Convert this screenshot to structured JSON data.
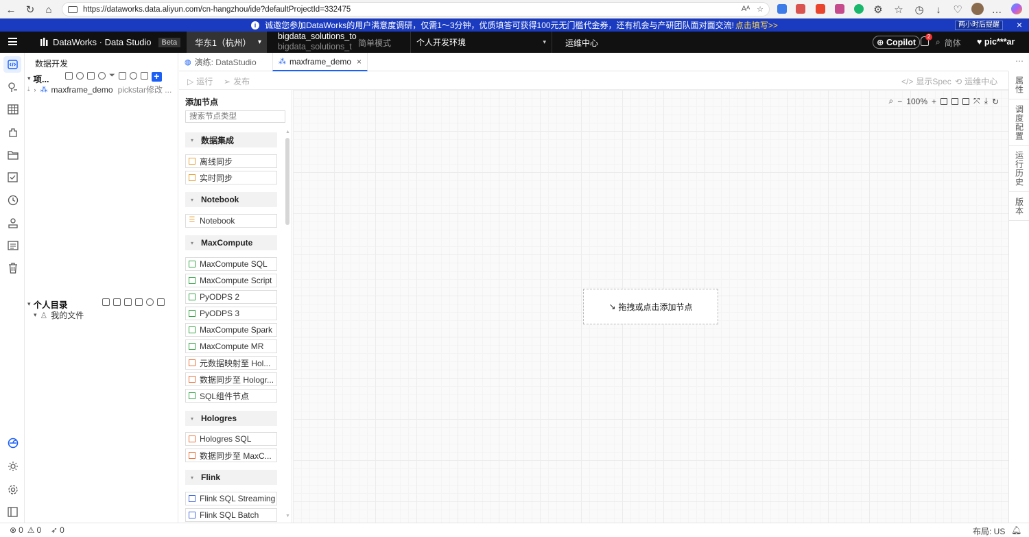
{
  "browser": {
    "url": "https://dataworks.data.aliyun.com/cn-hangzhou/ide?defaultProjectId=332475"
  },
  "banner": {
    "text": "诚邀您参加DataWorks的用户满意度调研，仅需1～3分钟，优质填答可获得100元无门槛代金券，还有机会与产研团队面对面交流!",
    "link": "点击填写>>",
    "remind": "两小时后提醒"
  },
  "topbar": {
    "logo": "DataWorks · Data Studio",
    "beta": "Beta",
    "region": "华东1（杭州）",
    "workspace": "bigdata_solutions_to",
    "workspace_sub": "bigdata_solutions_t",
    "mode": "简单模式",
    "env": "个人开发环境",
    "ops": "运维中心",
    "copilot": "Copilot",
    "bell_count": "2",
    "lang": "简体",
    "user": "pic***ar"
  },
  "explorer": {
    "title": "数据开发",
    "project_section": "项...",
    "tree_item_name": "maxframe_demo",
    "tree_item_meta": "pickstar修改 ...",
    "personal_section": "个人目录",
    "my_files": "我的文件"
  },
  "tabs": [
    {
      "label": "演练: DataStudio"
    },
    {
      "label": "maxframe_demo"
    }
  ],
  "toolbar": {
    "run": "运行",
    "publish": "发布",
    "show_spec": "显示Spec",
    "ops_center": "运维中心"
  },
  "node_panel": {
    "title": "添加节点",
    "search_placeholder": "搜索节点类型",
    "groups": [
      {
        "name": "数据集成",
        "nodes": [
          "离线同步",
          "实时同步"
        ]
      },
      {
        "name": "Notebook",
        "nodes": [
          "Notebook"
        ]
      },
      {
        "name": "MaxCompute",
        "nodes": [
          "MaxCompute SQL",
          "MaxCompute Script",
          "PyODPS 2",
          "PyODPS 3",
          "MaxCompute Spark",
          "MaxCompute MR",
          "元数据映射至 Hol...",
          "数据同步至 Hologr...",
          "SQL组件节点"
        ]
      },
      {
        "name": "Hologres",
        "nodes": [
          "Hologres SQL",
          "数据同步至 MaxC..."
        ]
      },
      {
        "name": "Flink",
        "nodes": [
          "Flink SQL Streaming",
          "Flink SQL Batch"
        ]
      }
    ]
  },
  "canvas": {
    "zoom": "100%",
    "drop_hint": "拖拽或点击添加节点"
  },
  "right_tabs": [
    "属性",
    "调度配置",
    "运行历史",
    "版本"
  ],
  "status": {
    "errors": "0",
    "warnings": "0",
    "messages": "0",
    "layout": "布局: US"
  },
  "colors": {
    "accent": "#1b5ff5",
    "banner": "#1a3bbf",
    "topbar": "#111111"
  }
}
